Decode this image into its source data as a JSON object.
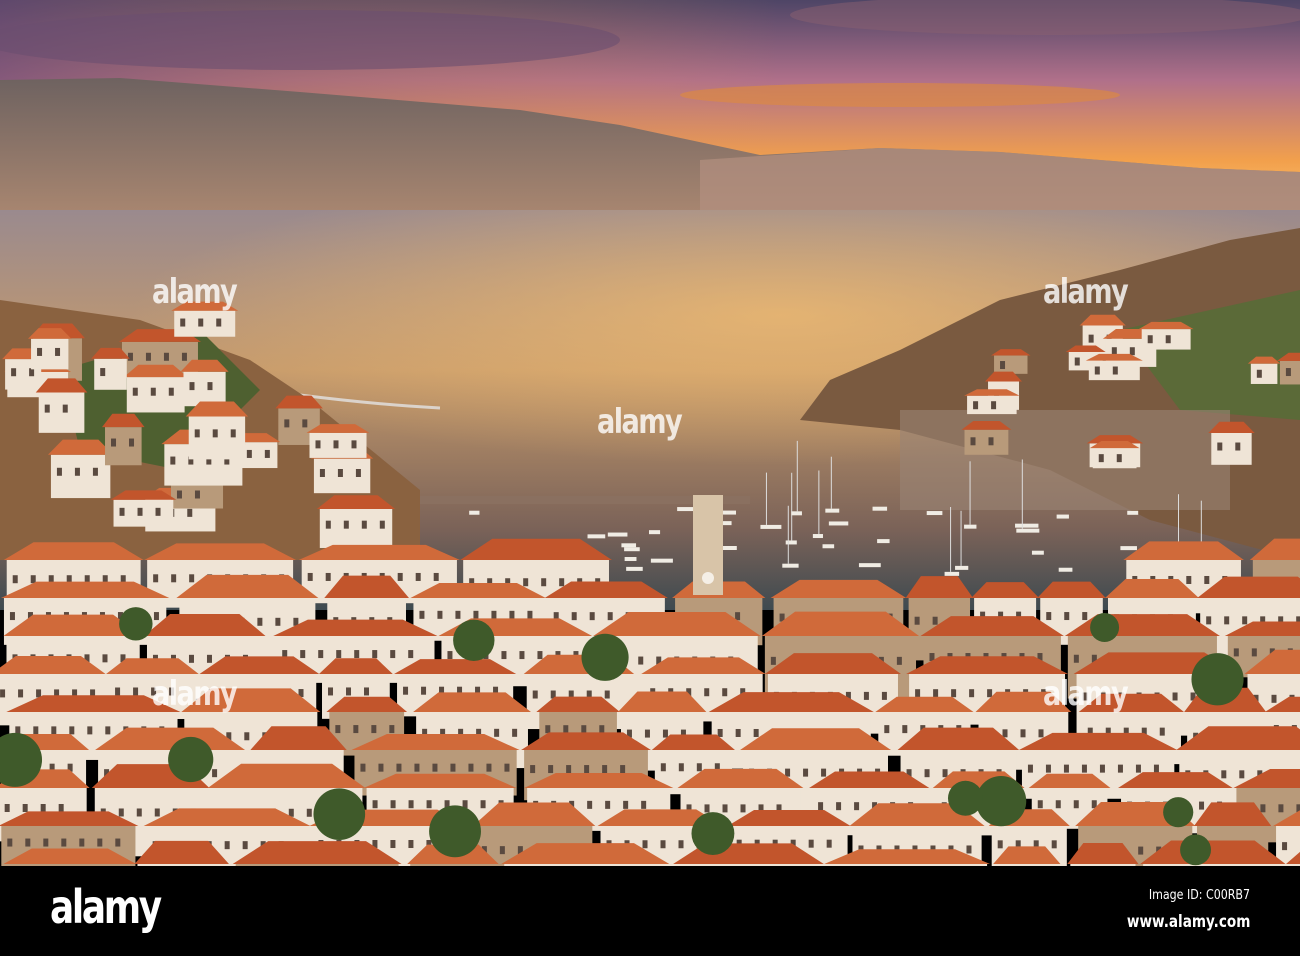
{
  "photo": {
    "subject": "harbour-town-sunset",
    "watermark": "alamy",
    "watermark_mark": "a",
    "colors": {
      "sky_top": "#5a4a6e",
      "sky_glow": "#f7b04a",
      "sea": "#c79868",
      "roof": "#c2552c",
      "wall": "#efe4d6"
    }
  },
  "footer": {
    "logo": "alamy",
    "image_id": "Image ID: C00RB7",
    "url": "www.alamy.com"
  }
}
